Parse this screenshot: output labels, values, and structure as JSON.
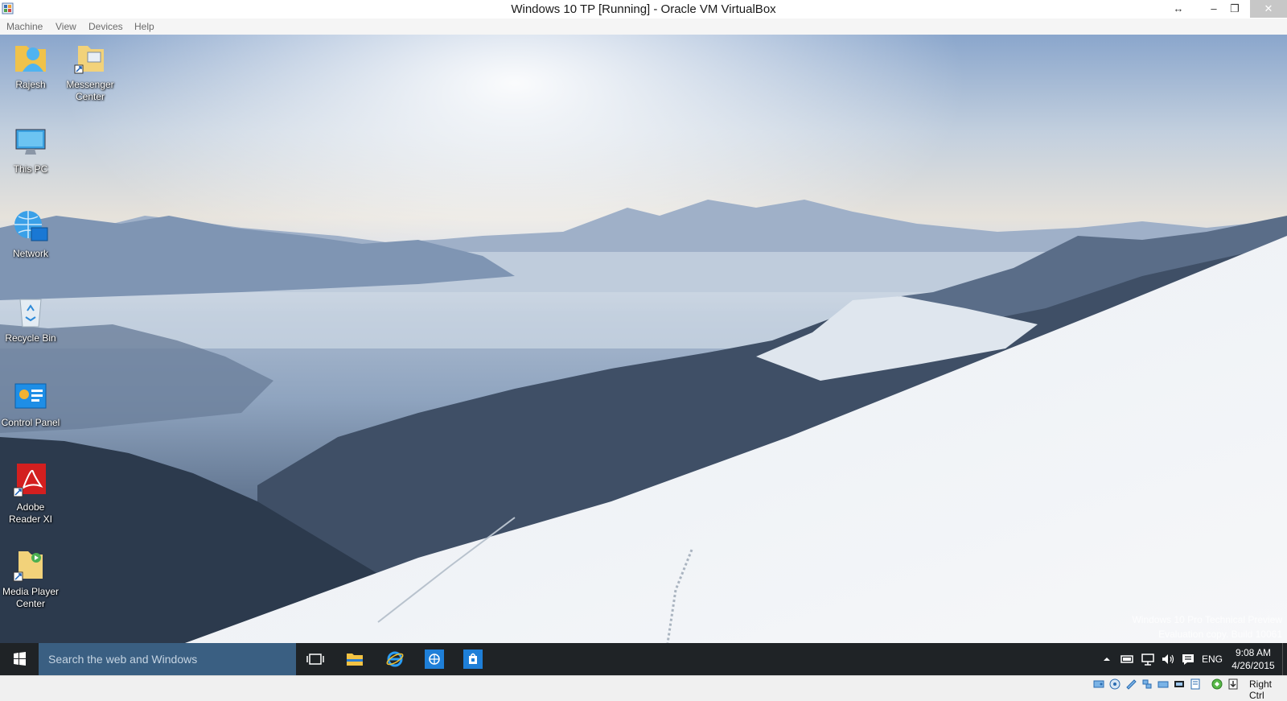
{
  "window": {
    "title": "Windows 10 TP [Running] - Oracle VM VirtualBox",
    "controls": {
      "resize": "↔",
      "minimize": "–",
      "maximize": "❐",
      "close": "✕"
    }
  },
  "menu": {
    "items": [
      "Machine",
      "View",
      "Devices",
      "Help"
    ]
  },
  "desktop": {
    "icons": [
      {
        "label_line1": "Rajesh",
        "label_line2": ""
      },
      {
        "label_line1": "Messenger",
        "label_line2": "Center"
      },
      {
        "label_line1": "This PC",
        "label_line2": ""
      },
      {
        "label_line1": "Network",
        "label_line2": ""
      },
      {
        "label_line1": "Recycle Bin",
        "label_line2": ""
      },
      {
        "label_line1": "Control Panel",
        "label_line2": ""
      },
      {
        "label_line1": "Adobe",
        "label_line2": "Reader XI"
      },
      {
        "label_line1": "Media Player",
        "label_line2": "Center"
      }
    ],
    "watermark": {
      "line1": "Windows 10 Pro Technical Preview",
      "line2": "Evaluation copy. Build 10061"
    }
  },
  "taskbar": {
    "search_placeholder": "Search the web and Windows",
    "tray": {
      "language": "ENG",
      "time": "9:08 AM",
      "date": "4/26/2015"
    }
  },
  "statusbar": {
    "host_key": "Right Ctrl"
  },
  "colors": {
    "taskbar": "#1f2326",
    "search": "#3a5f82",
    "accent": "#0078d7"
  }
}
